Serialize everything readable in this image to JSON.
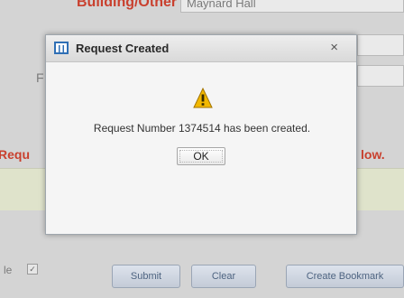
{
  "background_form": {
    "building_label": "Building/Other",
    "building_value": "Maynard Hall",
    "field_letter": "F",
    "request_notice_left": "Requ",
    "request_notice_right": "low.",
    "checkbox_label_fragment": "le",
    "buttons": {
      "submit": "Submit",
      "clear": "Clear",
      "bookmark": "Create Bookmark"
    }
  },
  "dialog": {
    "title": "Request Created",
    "close_glyph": "×",
    "message": "Request Number 1374514 has been created.",
    "ok_label": "OK"
  },
  "colors": {
    "accent_red": "#c9402e",
    "warning_yellow": "#f2b800",
    "app_icon_blue": "#2f6fb5"
  }
}
